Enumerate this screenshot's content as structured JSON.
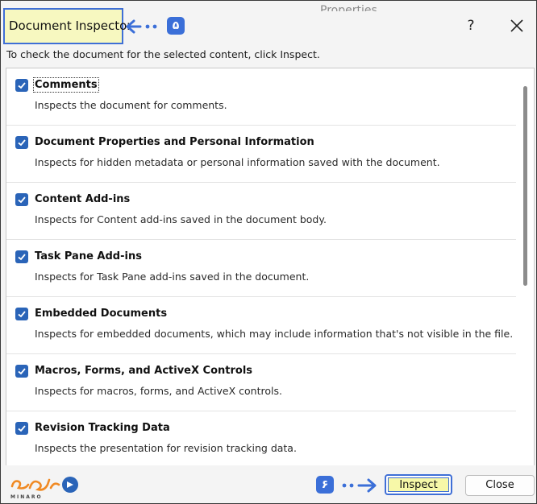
{
  "window": {
    "background_title": "Properties",
    "title": "Document Inspector",
    "help_label": "?",
    "close_icon": "close-icon"
  },
  "annotations": {
    "step_5": "۵",
    "step_6": "۶",
    "accent": "#3b6fd8",
    "highlight": "#f7f8c0"
  },
  "instruction": "To check the document for the selected content, click Inspect.",
  "items": [
    {
      "title": "Comments",
      "description": "Inspects the document for comments.",
      "checked": true
    },
    {
      "title": "Document Properties and Personal Information",
      "description": "Inspects for hidden metadata or personal information saved with the document.",
      "checked": true
    },
    {
      "title": "Content Add-ins",
      "description": "Inspects for Content add-ins saved in the document body.",
      "checked": true
    },
    {
      "title": "Task Pane Add-ins",
      "description": "Inspects for Task Pane add-ins saved in the document.",
      "checked": true
    },
    {
      "title": "Embedded Documents",
      "description": "Inspects for embedded documents, which may include information that's not visible in the file.",
      "checked": true
    },
    {
      "title": "Macros, Forms, and ActiveX Controls",
      "description": "Inspects for macros, forms, and ActiveX controls.",
      "checked": true
    },
    {
      "title": "Revision Tracking Data",
      "description": "Inspects the presentation for revision tracking data.",
      "checked": true
    }
  ],
  "footer": {
    "logo_text": "MINARO",
    "inspect_label": "Inspect",
    "close_label": "Close"
  }
}
